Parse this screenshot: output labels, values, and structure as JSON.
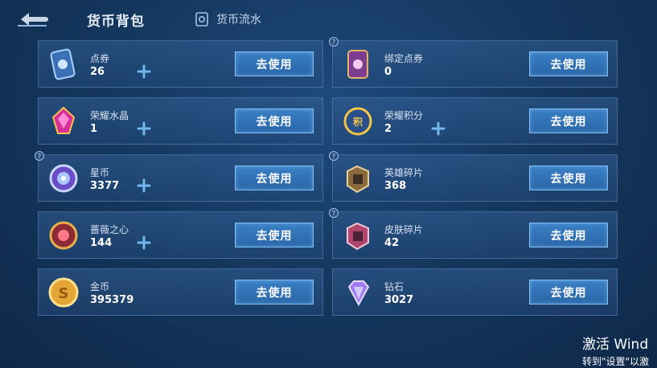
{
  "header": {
    "title": "货币背包",
    "flow_label": "货币流水"
  },
  "button_label": "去使用",
  "currencies": [
    {
      "name": "点券",
      "value": "26",
      "icon": "coupon-card-icon",
      "has_plus": true,
      "has_help": false
    },
    {
      "name": "绑定点券",
      "value": "0",
      "icon": "bound-coupon-card-icon",
      "has_plus": false,
      "has_help": true
    },
    {
      "name": "荣耀水晶",
      "value": "1",
      "icon": "glory-crystal-icon",
      "has_plus": true,
      "has_help": false
    },
    {
      "name": "荣耀积分",
      "value": "2",
      "icon": "glory-points-icon",
      "has_plus": true,
      "has_help": false
    },
    {
      "name": "星币",
      "value": "3377",
      "icon": "star-coin-icon",
      "has_plus": true,
      "has_help": true
    },
    {
      "name": "英雄碎片",
      "value": "368",
      "icon": "hero-fragment-icon",
      "has_plus": false,
      "has_help": true
    },
    {
      "name": "蔷薇之心",
      "value": "144",
      "icon": "rose-heart-icon",
      "has_plus": true,
      "has_help": false
    },
    {
      "name": "皮肤碎片",
      "value": "42",
      "icon": "skin-fragment-icon",
      "has_plus": false,
      "has_help": true
    },
    {
      "name": "金币",
      "value": "395379",
      "icon": "gold-coin-icon",
      "has_plus": false,
      "has_help": false
    },
    {
      "name": "钻石",
      "value": "3027",
      "icon": "diamond-icon",
      "has_plus": false,
      "has_help": false
    }
  ],
  "watermark": {
    "line1": "激活 Wind",
    "line2": "转到\"设置\"以激"
  },
  "colors": {
    "accent": "#3a7fc4",
    "button_border": "#7fc2f5",
    "plus": "#6fb8ee"
  }
}
